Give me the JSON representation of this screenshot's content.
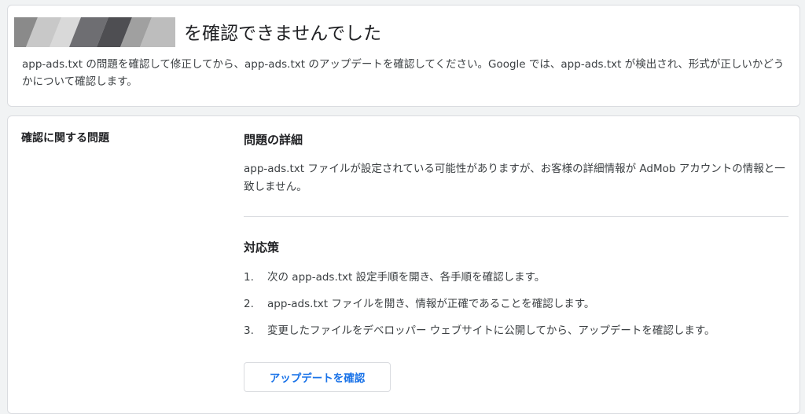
{
  "header": {
    "title": "を確認できませんでした",
    "description": "app-ads.txt の問題を確認して修正してから、app-ads.txt のアップデートを確認してください。Google では、app-ads.txt が検出され、形式が正しいかどうかについて確認します。"
  },
  "issue": {
    "label": "確認に関する問題",
    "details_title": "問題の詳細",
    "details_text": "app-ads.txt ファイルが設定されている可能性がありますが、お客様の詳細情報が AdMob アカウントの情報と一致しません。",
    "solution_title": "対応策",
    "steps": [
      {
        "num": "1.",
        "text": "次の app-ads.txt 設定手順を開き、各手順を確認します。"
      },
      {
        "num": "2.",
        "text": "app-ads.txt ファイルを開き、情報が正確であることを確認します。"
      },
      {
        "num": "3.",
        "text": "変更したファイルをデベロッパー ウェブサイトに公開してから、アップデートを確認します。"
      }
    ],
    "button_label": "アップデートを確認"
  },
  "colors": {
    "accent": "#1a73e8",
    "border": "#dadce0",
    "background": "#f1f3f4"
  }
}
